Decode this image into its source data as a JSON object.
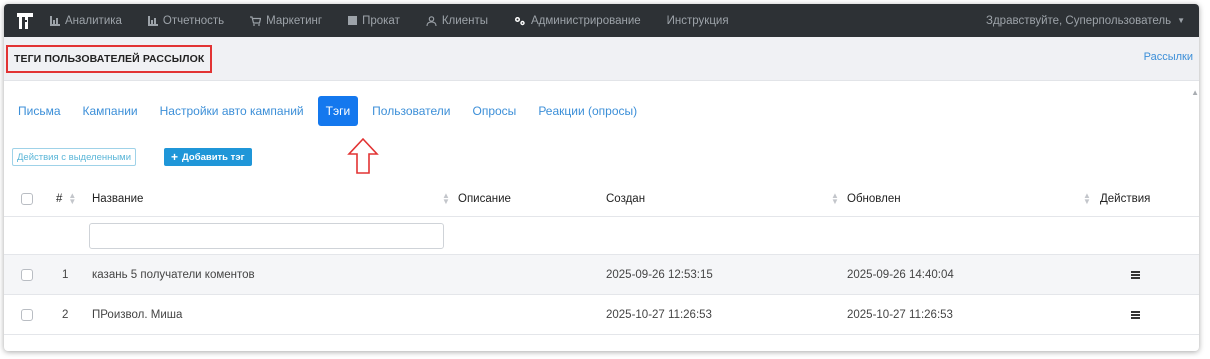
{
  "nav": {
    "items": [
      {
        "label": "Аналитика",
        "icon": "bar-chart-icon"
      },
      {
        "label": "Отчетность",
        "icon": "bar-chart-icon"
      },
      {
        "label": "Маркетинг",
        "icon": "cart-icon"
      },
      {
        "label": "Прокат",
        "icon": "square-icon"
      },
      {
        "label": "Клиенты",
        "icon": "users-icon"
      },
      {
        "label": "Администрирование",
        "icon": "gears-icon"
      },
      {
        "label": "Инструкция",
        "icon": ""
      }
    ],
    "user_greeting": "Здравствуйте, Суперпользователь",
    "logo_icon": "brand-logo-icon",
    "colors": {
      "background": "#2d3135",
      "text": "#9da3a9"
    }
  },
  "header": {
    "title": "ТЕГИ ПОЛЬЗОВАТЕЛЕЙ РАССЫЛОК",
    "link": "Рассылки"
  },
  "tabs": [
    {
      "label": "Письма",
      "active": false
    },
    {
      "label": "Кампании",
      "active": false
    },
    {
      "label": "Настройки авто кампаний",
      "active": false
    },
    {
      "label": "Тэги",
      "active": true
    },
    {
      "label": "Пользователи",
      "active": false
    },
    {
      "label": "Опросы",
      "active": false
    },
    {
      "label": "Реакции (опросы)",
      "active": false
    }
  ],
  "toolbar": {
    "bulk_actions_label": "Действия с выделенными",
    "add_tag_label": "Добавить тэг"
  },
  "table": {
    "columns": {
      "number": "#",
      "name": "Название",
      "description": "Описание",
      "created": "Создан",
      "updated": "Обновлен",
      "actions": "Действия"
    },
    "filter_name_value": "",
    "rows": [
      {
        "number": "1",
        "name": "казань 5 получатели коментов",
        "description": "",
        "created": "2025-09-26 12:53:15",
        "updated": "2025-09-26 14:40:04"
      },
      {
        "number": "2",
        "name": "ПРоизвол. Миша",
        "description": "",
        "created": "2025-10-27 11:26:53",
        "updated": "2025-10-27 11:26:53"
      }
    ]
  },
  "colors": {
    "accent": "#1478ee",
    "link": "#3c8fd8",
    "highlight_border": "#e23333"
  }
}
